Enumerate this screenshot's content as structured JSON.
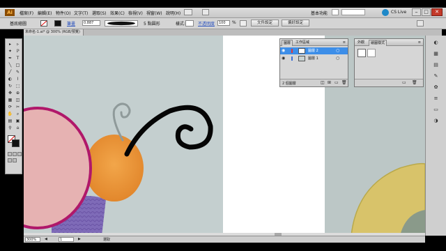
{
  "menubar": {
    "logo": "Ai",
    "items": [
      "檔案(F)",
      "編輯(E)",
      "物件(O)",
      "文字(T)",
      "選取(S)",
      "效果(C)",
      "檢視(V)",
      "視窗(W)",
      "說明(H)"
    ],
    "workspace": "基本功能",
    "cs_live": "CS Live"
  },
  "controlbar": {
    "selection_label": "基底繪圖",
    "stroke_label": "筆畫",
    "stroke_value": "0.887",
    "brush_label": "5 點圓形",
    "style_label": "樣式:",
    "opacity_label": "不透明度",
    "opacity_value": "100",
    "percent": "%",
    "doc_setup_button": "文件設定",
    "prefs_button": "偏好設定"
  },
  "document": {
    "tab_title": "未命名-1.ai* @ 300% (RGB/預覽)"
  },
  "toolbox": {
    "tools": [
      "▸",
      "▹",
      "✦",
      "ℙ",
      "✒",
      "T",
      "╲",
      "□",
      "╱",
      "✎",
      "◐",
      "⌇",
      "↻",
      "⬚",
      "✥",
      "⊕",
      "▦",
      "◫",
      "⟳",
      "✂",
      "✋",
      "⌕",
      "▤",
      "▣",
      "⚲",
      "⌂"
    ]
  },
  "layers_panel": {
    "tabs": [
      "圖層",
      "工作區域"
    ],
    "layers": [
      {
        "name": "圖層 2",
        "selected": true,
        "color": "#2f7fe0"
      },
      {
        "name": "圖層 1",
        "selected": false,
        "color": "#3a6fd8"
      }
    ],
    "footer": "2 個圖層"
  },
  "swatches_panel": {
    "tabs": [
      "外觀",
      "繪圖樣式"
    ]
  },
  "statusbar": {
    "zoom": "300%",
    "page": "1",
    "tool_name": "選取"
  },
  "colors": {
    "accent": "#2f7fe0",
    "artwork_magenta": "#b0186a",
    "artwork_pink": "#e6b2b2"
  }
}
